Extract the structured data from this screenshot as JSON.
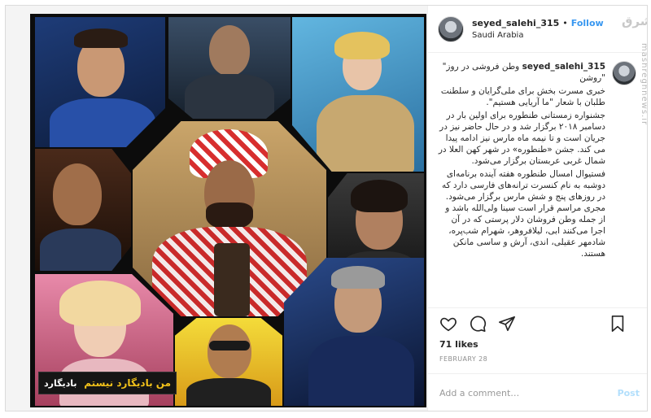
{
  "header": {
    "username": "seyed_salehi_315",
    "separator": "•",
    "follow_label": "Follow",
    "location": "Saudi Arabia",
    "watermark_logo": "مشرق",
    "watermark_site": "mashreghnews.ir"
  },
  "caption": {
    "username": "seyed_salehi_315",
    "paragraphs": [
      "وطن فروشی در روز\" \"روشن",
      "خبری مسرت بخش برای ملی‌گرایان و سلطنت طلبان با شعار \"ما آریایی هستیم\".",
      "جشنواره زمستانی طنطوره برای اولین بار در دسامبر ۲۰۱۸ برگزار شد و در حال حاضر نیز در جریان است و تا نیمه ماه مارس نیز ادامه پیدا می کند. جشن «طنطوره» در شهر کهن العلا در شمال غربی عربستان برگزار می‌شود.",
      "فستیوال امسال طنطوره هفته آینده برنامه‌ای دوشبه به نام کنسرت ترانه‌های فارسی دارد که در روزهای پنج و شش مارس برگزار می‌شود. مجری مراسم قرار است سینا ولی‌الله باشد و از جمله وطن فروشان دلار پرستی که در آن اجرا می‌کنند ابی، لیلافروهر، شهرام شب‌پره، شادمهر عقیلی، اندی، آرش و ساسی مانکن هستند."
    ]
  },
  "media": {
    "banner_text": "من بادیگارد نیستم",
    "banner_logo": "بادیگارد"
  },
  "actions": {
    "like_icon": "heart-icon",
    "comment_icon": "comment-icon",
    "share_icon": "share-icon",
    "save_icon": "bookmark-icon"
  },
  "likes_label": "71 likes",
  "date_label": "FEBRUARY 28",
  "comment_box": {
    "placeholder": "Add a comment…",
    "post_label": "Post"
  }
}
